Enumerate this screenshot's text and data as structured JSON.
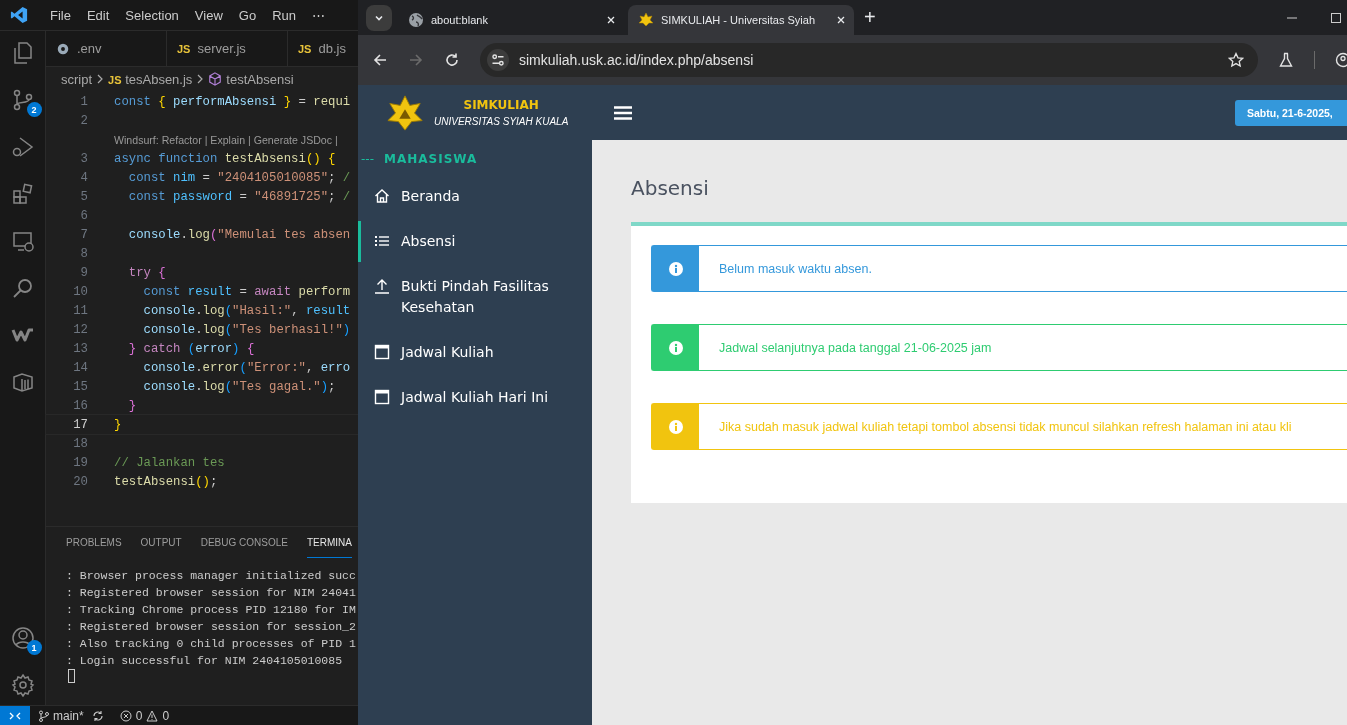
{
  "vscode": {
    "menu": [
      "File",
      "Edit",
      "Selection",
      "View",
      "Go",
      "Run",
      "⋯"
    ],
    "activity_badges": {
      "source_control": "2",
      "accounts": "1"
    },
    "editor_tabs": [
      {
        "label": ".env"
      },
      {
        "badge": "JS",
        "label": "server.js"
      },
      {
        "badge": "JS",
        "label": "db.js"
      }
    ],
    "breadcrumb": {
      "folder": "script",
      "file_badge": "JS",
      "file": "tesAbsen.js",
      "symbol": "testAbsensi"
    },
    "lines": [
      {
        "kind": "code",
        "number": "1",
        "current": false,
        "tokens": [
          {
            "text": "const ",
            "kind": "kw"
          },
          {
            "text": "{ ",
            "kind": "b1"
          },
          {
            "text": "performAbsensi ",
            "kind": "var"
          },
          {
            "text": "} ",
            "kind": "b1"
          },
          {
            "text": "= ",
            "kind": "plain"
          },
          {
            "text": "requi",
            "kind": "fn"
          }
        ]
      },
      {
        "kind": "code",
        "number": "2",
        "current": false
      },
      {
        "kind": "codelens",
        "text": "Windsurf: Refactor | Explain | Generate JSDoc |"
      },
      {
        "kind": "code",
        "number": "3",
        "current": false,
        "tokens": [
          {
            "text": "async ",
            "kind": "kw"
          },
          {
            "text": "function ",
            "kind": "kw"
          },
          {
            "text": "testAbsensi",
            "kind": "fn"
          },
          {
            "text": "() {",
            "kind": "b1"
          }
        ]
      },
      {
        "kind": "code",
        "number": "4",
        "current": false,
        "tokens": [
          {
            "text": "  const ",
            "kind": "kw"
          },
          {
            "text": "nim ",
            "kind": "cvar"
          },
          {
            "text": "= ",
            "kind": "plain"
          },
          {
            "text": "\"2404105010085\"",
            "kind": "str"
          },
          {
            "text": "; ",
            "kind": "plain"
          },
          {
            "text": "/",
            "kind": "cmt"
          }
        ]
      },
      {
        "kind": "code",
        "number": "5",
        "current": false,
        "tokens": [
          {
            "text": "  const ",
            "kind": "kw"
          },
          {
            "text": "password ",
            "kind": "cvar"
          },
          {
            "text": "= ",
            "kind": "plain"
          },
          {
            "text": "\"46891725\"",
            "kind": "str"
          },
          {
            "text": "; ",
            "kind": "plain"
          },
          {
            "text": "/",
            "kind": "cmt"
          }
        ]
      },
      {
        "kind": "code",
        "number": "6",
        "current": false
      },
      {
        "kind": "code",
        "number": "7",
        "current": false,
        "tokens": [
          {
            "text": "  console",
            "kind": "var"
          },
          {
            "text": ".",
            "kind": "plain"
          },
          {
            "text": "log",
            "kind": "fn"
          },
          {
            "text": "(",
            "kind": "b2"
          },
          {
            "text": "\"Memulai tes absen",
            "kind": "str"
          }
        ]
      },
      {
        "kind": "code",
        "number": "8",
        "current": false
      },
      {
        "kind": "code",
        "number": "9",
        "current": false,
        "tokens": [
          {
            "text": "  try ",
            "kind": "ctrl"
          },
          {
            "text": "{",
            "kind": "b2"
          }
        ]
      },
      {
        "kind": "code",
        "number": "10",
        "current": false,
        "tokens": [
          {
            "text": "    const ",
            "kind": "kw"
          },
          {
            "text": "result ",
            "kind": "cvar"
          },
          {
            "text": "= ",
            "kind": "plain"
          },
          {
            "text": "await ",
            "kind": "ctrl"
          },
          {
            "text": "perform",
            "kind": "fn"
          }
        ]
      },
      {
        "kind": "code",
        "number": "11",
        "current": false,
        "tokens": [
          {
            "text": "    console",
            "kind": "var"
          },
          {
            "text": ".",
            "kind": "plain"
          },
          {
            "text": "log",
            "kind": "fn"
          },
          {
            "text": "(",
            "kind": "b3"
          },
          {
            "text": "\"Hasil:\"",
            "kind": "str"
          },
          {
            "text": ", ",
            "kind": "plain"
          },
          {
            "text": "result",
            "kind": "cvar"
          }
        ]
      },
      {
        "kind": "code",
        "number": "12",
        "current": false,
        "tokens": [
          {
            "text": "    console",
            "kind": "var"
          },
          {
            "text": ".",
            "kind": "plain"
          },
          {
            "text": "log",
            "kind": "fn"
          },
          {
            "text": "(",
            "kind": "b3"
          },
          {
            "text": "\"Tes berhasil!\"",
            "kind": "str"
          },
          {
            "text": ")",
            "kind": "b3"
          }
        ]
      },
      {
        "kind": "code",
        "number": "13",
        "current": false,
        "tokens": [
          {
            "text": "  } ",
            "kind": "b2"
          },
          {
            "text": "catch ",
            "kind": "ctrl"
          },
          {
            "text": "(",
            "kind": "b3"
          },
          {
            "text": "error",
            "kind": "var"
          },
          {
            "text": ") ",
            "kind": "b3"
          },
          {
            "text": "{",
            "kind": "b2"
          }
        ]
      },
      {
        "kind": "code",
        "number": "14",
        "current": false,
        "tokens": [
          {
            "text": "    console",
            "kind": "var"
          },
          {
            "text": ".",
            "kind": "plain"
          },
          {
            "text": "error",
            "kind": "fn"
          },
          {
            "text": "(",
            "kind": "b3"
          },
          {
            "text": "\"Error:\"",
            "kind": "str"
          },
          {
            "text": ", ",
            "kind": "plain"
          },
          {
            "text": "erro",
            "kind": "var"
          }
        ]
      },
      {
        "kind": "code",
        "number": "15",
        "current": false,
        "tokens": [
          {
            "text": "    console",
            "kind": "var"
          },
          {
            "text": ".",
            "kind": "plain"
          },
          {
            "text": "log",
            "kind": "fn"
          },
          {
            "text": "(",
            "kind": "b3"
          },
          {
            "text": "\"Tes gagal.\"",
            "kind": "str"
          },
          {
            "text": ")",
            "kind": "b3"
          },
          {
            "text": ";",
            "kind": "plain"
          }
        ]
      },
      {
        "kind": "code",
        "number": "16",
        "current": false,
        "tokens": [
          {
            "text": "  }",
            "kind": "b2"
          }
        ]
      },
      {
        "kind": "code",
        "number": "17",
        "current": true,
        "tokens": [
          {
            "text": "}",
            "kind": "b1"
          }
        ]
      },
      {
        "kind": "code",
        "number": "18",
        "current": false
      },
      {
        "kind": "code",
        "number": "19",
        "current": false,
        "tokens": [
          {
            "text": "// Jalankan tes",
            "kind": "cmt"
          }
        ]
      },
      {
        "kind": "code",
        "number": "20",
        "current": false,
        "tokens": [
          {
            "text": "testAbsensi",
            "kind": "fn"
          },
          {
            "text": "()",
            "kind": "b1"
          },
          {
            "text": ";",
            "kind": "plain"
          }
        ]
      }
    ],
    "panel_tabs": [
      {
        "label": "PROBLEMS",
        "selected": false
      },
      {
        "label": "OUTPUT",
        "selected": false
      },
      {
        "label": "DEBUG CONSOLE",
        "selected": false
      },
      {
        "label": "TERMINA",
        "selected": true
      }
    ],
    "terminal": [
      ": Browser process manager initialized succ",
      ": Registered browser session for NIM 24041",
      ": Tracking Chrome process PID 12180 for IM",
      ": Registered browser session for session_2",
      ": Also tracking 0 child processes of PID 1",
      ": Login successful for NIM 2404105010085"
    ],
    "status_bar": {
      "branch": "main*",
      "errors": "0",
      "warnings": "0"
    }
  },
  "browser": {
    "tabs": [
      {
        "title": "about:blank",
        "selected": false
      },
      {
        "title": "SIMKULIAH - Universitas Syiah",
        "selected": true
      }
    ],
    "new_tab": "+",
    "address": "simkuliah.usk.ac.id/index.php/absensi",
    "forward_disabled": true,
    "site": {
      "brand": "SIMKULIAH",
      "subtitle": "UNIVERSITAS SYIAH KUALA",
      "date": "Sabtu, 21-6-2025,",
      "sidebar": {
        "section": "MAHASISWA",
        "section_mark": "---",
        "items": [
          {
            "label": "Beranda",
            "selected": false
          },
          {
            "label": "Absensi",
            "selected": true
          },
          {
            "label": "Bukti Pindah Fasilitas Kesehatan",
            "selected": false
          },
          {
            "label": "Jadwal Kuliah",
            "selected": false
          },
          {
            "label": "Jadwal Kuliah Hari Ini",
            "selected": false
          }
        ]
      },
      "page_title": "Absensi",
      "alerts": [
        {
          "text": "Belum masuk waktu absen.",
          "color": "#3498db"
        },
        {
          "text": "Jadwal selanjutnya pada tanggal 21-06-2025 jam",
          "color": "#2ecc71"
        },
        {
          "text": "Jika sudah masuk jadwal kuliah tetapi tombol absensi tidak muncul silahkan refresh halaman ini atau kli",
          "color": "#f1c40f"
        }
      ]
    }
  }
}
